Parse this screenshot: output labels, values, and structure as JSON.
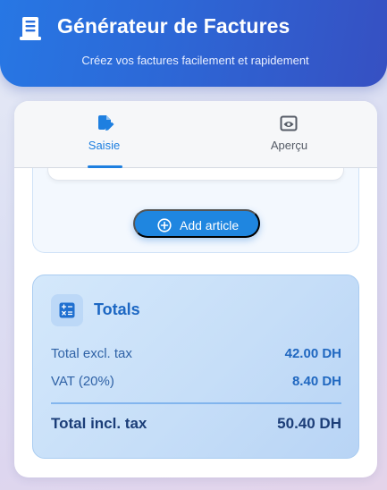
{
  "header": {
    "title": "Générateur de Factures",
    "subtitle": "Créez vos factures facilement et rapidement",
    "icon": "invoice-icon"
  },
  "tabs": [
    {
      "label": "Saisie",
      "icon": "edit-document-icon",
      "active": true
    },
    {
      "label": "Aperçu",
      "icon": "preview-eye-icon",
      "active": false
    }
  ],
  "articles": {
    "add_label": "Add article",
    "add_icon": "plus-circle-icon"
  },
  "totals": {
    "title": "Totals",
    "icon": "calculator-icon",
    "excl_label": "Total excl. tax",
    "excl_value": "42.00 DH",
    "vat_label": "VAT (20%)",
    "vat_value": "8.40 DH",
    "incl_label": "Total incl. tax",
    "incl_value": "50.40 DH"
  },
  "colors": {
    "accent": "#1e7fe0",
    "header_gradient_start": "#2777e4",
    "header_gradient_end": "#3650c2",
    "total_text": "#1c3e78"
  }
}
